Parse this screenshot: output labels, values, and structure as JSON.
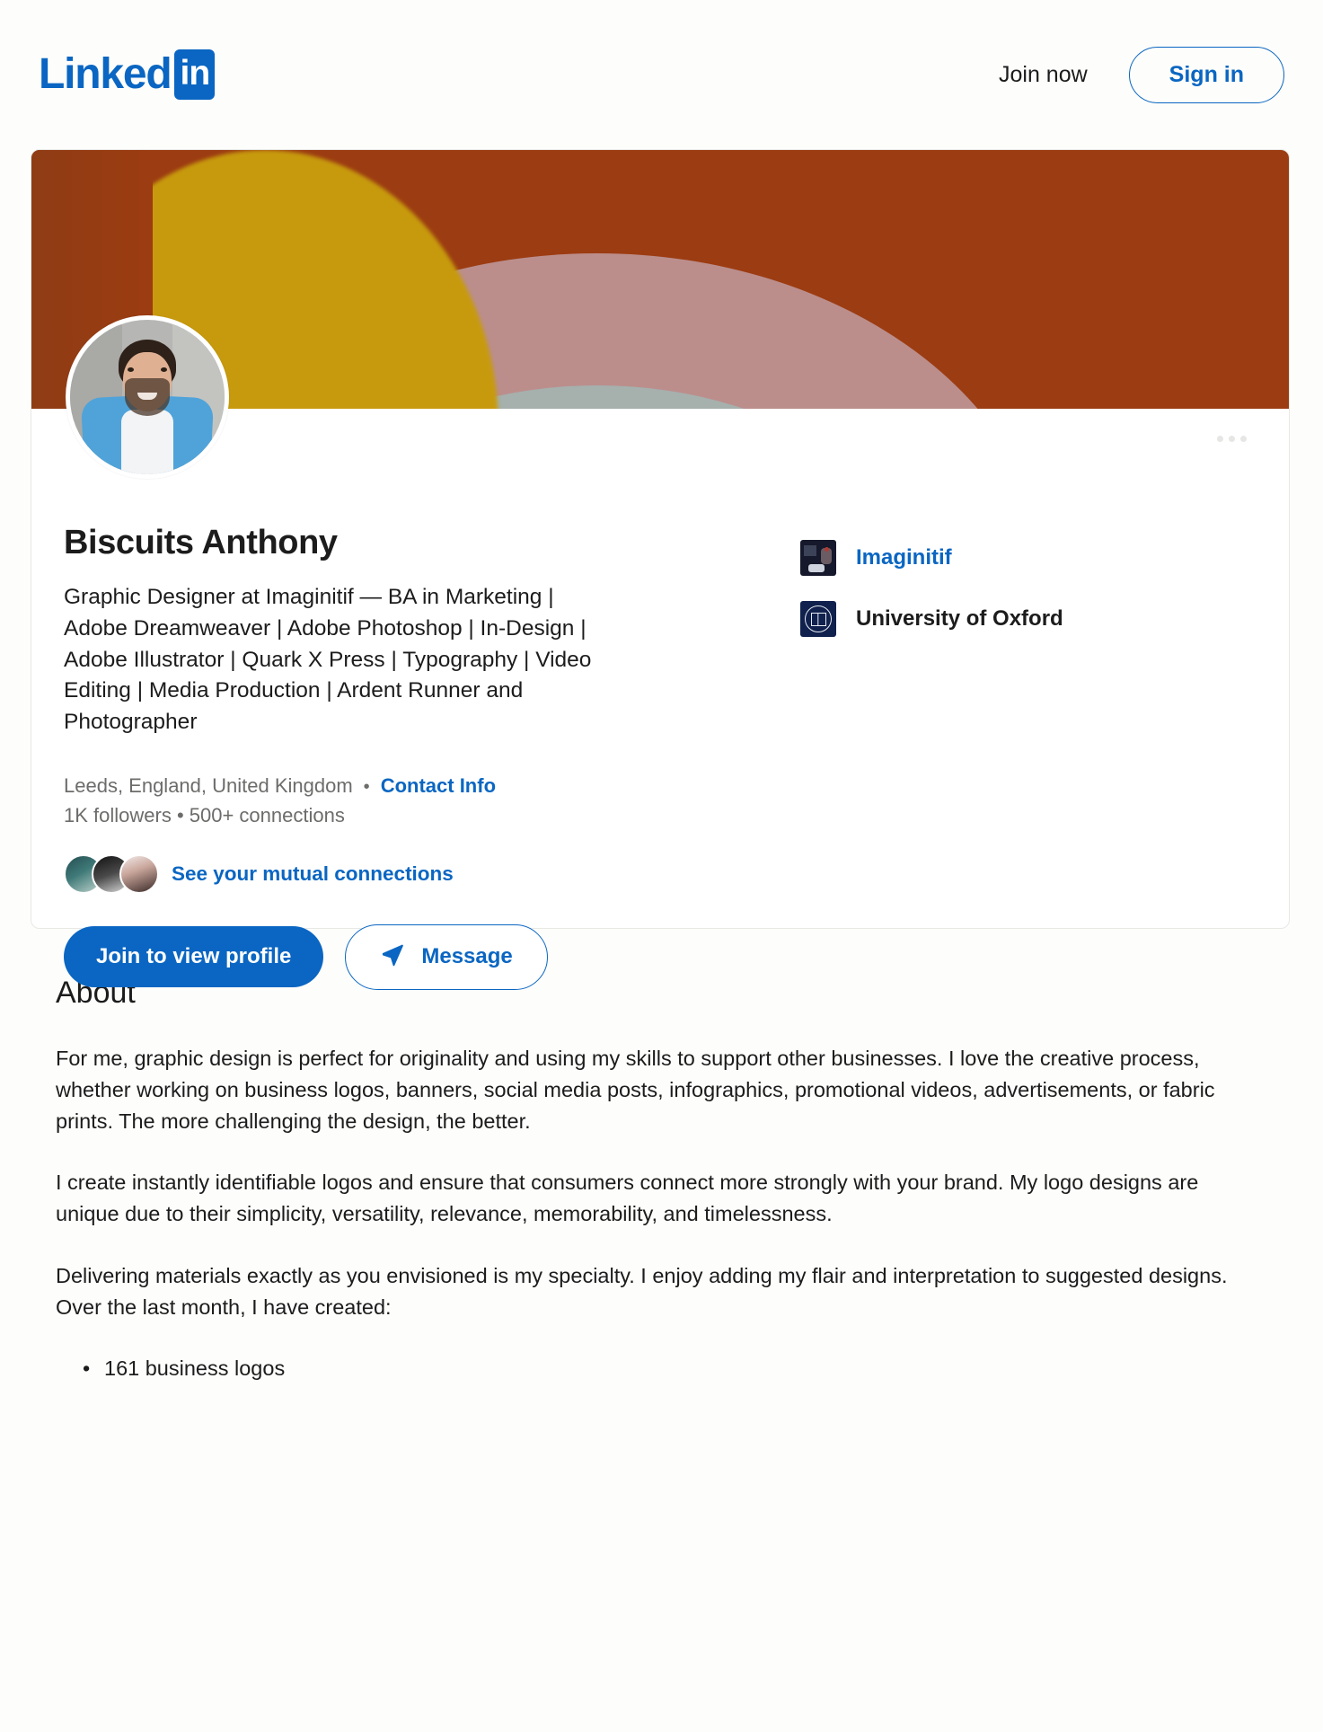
{
  "brand": {
    "logo_text": "Linked",
    "logo_badge": "in",
    "accent_color": "#0a66c2"
  },
  "topnav": {
    "join_now_label": "Join now",
    "sign_in_label": "Sign in"
  },
  "profile": {
    "name": "Biscuits Anthony",
    "headline": "Graphic Designer at Imaginitif — BA in Marketing | Adobe Dreamweaver | Adobe Photoshop | In-Design | Adobe Illustrator | Quark X Press | Typography | Video Editing | Media Production | Ardent Runner and Photographer",
    "location": "Leeds, England, United Kingdom",
    "separator": "•",
    "contact_info_label": "Contact Info",
    "counts": "1K followers • 500+ connections",
    "mutual_connections_label": "See your mutual connections",
    "primary_button_label": "Join to view profile",
    "secondary_button_label": "Message",
    "overflow_menu_label": "More actions"
  },
  "affiliations": [
    {
      "name": "Imaginitif",
      "type": "company",
      "is_link": true
    },
    {
      "name": "University of Oxford",
      "type": "school",
      "is_link": false
    }
  ],
  "about": {
    "title": "About",
    "paragraphs": [
      "For me, graphic design is perfect for originality and using my skills to support other businesses. I love the creative process, whether working on business logos, banners, social media posts, infographics, promotional videos, advertisements, or fabric prints. The more challenging the design, the better.",
      "I create instantly identifiable logos and ensure that consumers connect more strongly with your brand. My logo designs are unique due to their simplicity, versatility, relevance, memorability, and timelessness.",
      "Delivering materials exactly as you envisioned is my specialty. I enjoy adding my flair and interpretation to suggested designs. Over the last month, I have created:"
    ],
    "list_items": [
      "161 business logos"
    ]
  }
}
